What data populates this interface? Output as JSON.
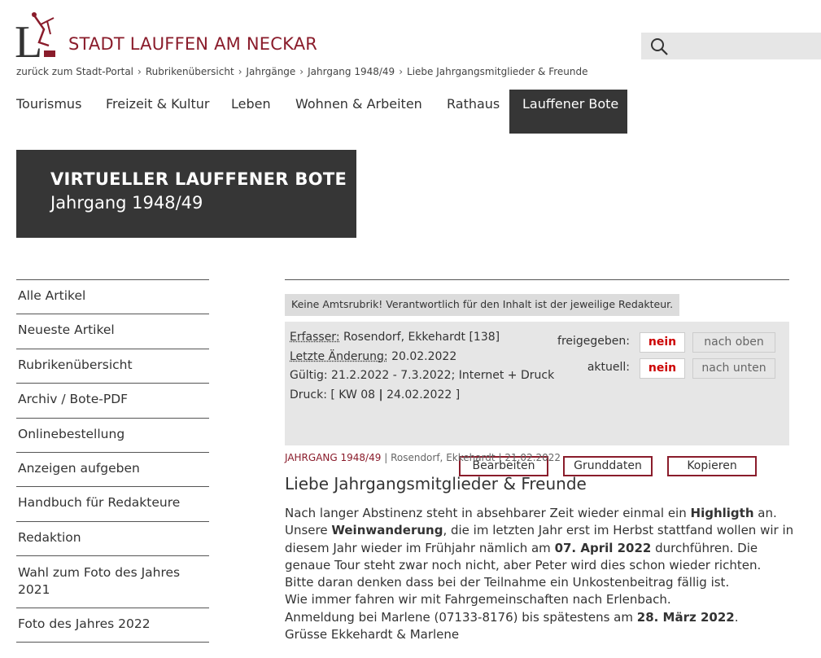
{
  "header": {
    "site_title": "STADT LAUFFEN AM NECKAR",
    "logo_letter": "L",
    "search_placeholder": ""
  },
  "breadcrumb": [
    "zurück zum Stadt-Portal",
    "Rubrikenübersicht",
    "Jahrgänge",
    "Jahrgang 1948/49",
    "Liebe Jahrgangsmitglieder & Freunde"
  ],
  "nav": {
    "items": [
      "Tourismus",
      "Freizeit & Kultur",
      "Leben",
      "Wohnen & Arbeiten",
      "Rathaus",
      "Lauffener Bote"
    ],
    "active": "Lauffener Bote"
  },
  "hero": {
    "title": "VIRTUELLER LAUFFENER BOTE",
    "subtitle": "Jahrgang 1948/49"
  },
  "sidebar": {
    "items": [
      "Alle Artikel",
      "Neueste Artikel",
      "Rubrikenübersicht",
      "Archiv / Bote-PDF",
      "Onlinebestellung",
      "Anzeigen aufgeben",
      "Handbuch für Redakteure",
      "Redaktion",
      "Wahl zum Foto des Jahres 2021",
      "Foto des Jahres 2022"
    ]
  },
  "notice": "Keine Amtsrubrik! Verantwortlich für den Inhalt ist der jeweilige Redakteur.",
  "info": {
    "erfasser_label": "Erfasser:",
    "erfasser_value": "Rosendorf, Ekkehardt [138]",
    "aenderung_label": "Letzte Änderung:",
    "aenderung_value": "20.02.2022",
    "gueltig": "Gültig: 21.2.2022 - 7.3.2022; Internet + Druck",
    "druck_prefix": "Druck: [ KW 08 ",
    "druck_sep": "|",
    "druck_suffix": " 24.02.2022 ]",
    "freigegeben_label": "freigegeben:",
    "freigegeben_value": "nein",
    "aktuell_label": "aktuell:",
    "aktuell_value": "nein",
    "btn_up": "nach oben",
    "btn_down": "nach unten",
    "btn_edit": "Bearbeiten",
    "btn_base": "Grunddaten",
    "btn_copy": "Kopieren"
  },
  "article": {
    "category": "JAHRGANG 1948/49",
    "author": "Rosendorf, Ekkehardt",
    "date": "21.02.2022",
    "meta_sep": "|",
    "title": "Liebe Jahrgangsmitglieder & Freunde",
    "l1a": "Nach langer Abstinenz steht in absehbarer Zeit wieder einmal ein ",
    "l1b": "Highligth",
    "l1c": " an.",
    "l2a": "Unsere ",
    "l2b": "Weinwanderung",
    "l2c": ", die im letzten Jahr erst im Herbst stattfand wollen wir in",
    "l3a": "diesem Jahr wieder im Frühjahr nämlich am ",
    "l3b": "07. April 2022",
    "l3c": " durchführen. Die",
    "l4": "genaue Tour steht zwar noch nicht, aber Peter wird dies schon wieder richten.",
    "l5": "Bitte daran denken dass bei der Teilnahme ein Unkostenbeitrag fällig ist.",
    "l6": "Wie immer fahren wir mit Fahrgemeinschaften nach Erlenbach.",
    "l7a": "Anmeldung bei Marlene (07133-8176) bis spätestens am ",
    "l7b": "28. März 2022",
    "l7c": ".",
    "l8": "Grüsse Ekkehardt & Marlene"
  },
  "colors": {
    "brand": "#8a1c2b",
    "dark": "#363636",
    "status_red": "#cc0000"
  }
}
